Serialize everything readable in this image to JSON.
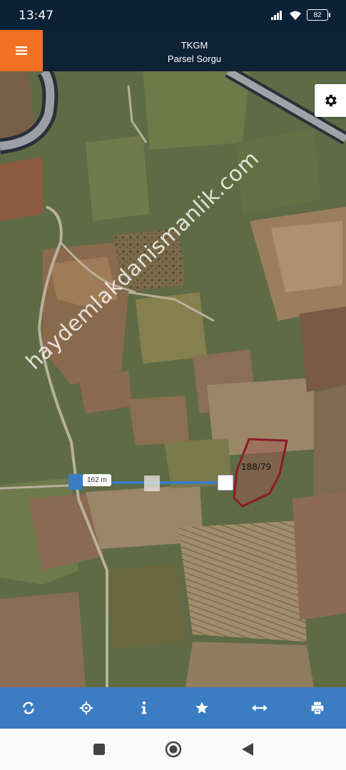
{
  "status_bar": {
    "time": "13:47",
    "battery": "82"
  },
  "header": {
    "title": "TKGM",
    "subtitle": "Parsel Sorgu"
  },
  "map": {
    "parcel_label": "188/79",
    "measure_label": "162 m",
    "watermark": "haydemlakdanismanlik.com",
    "parcel_color": "#8b1a2b",
    "measure_color": "#3a7dc2"
  },
  "toolbar": {
    "icons": [
      "refresh-icon",
      "locate-icon",
      "info-icon",
      "favorite-icon",
      "measure-icon",
      "print-icon"
    ]
  },
  "colors": {
    "accent": "#f36f21",
    "header": "#0e2235",
    "toolbar": "#3a7dc2"
  }
}
